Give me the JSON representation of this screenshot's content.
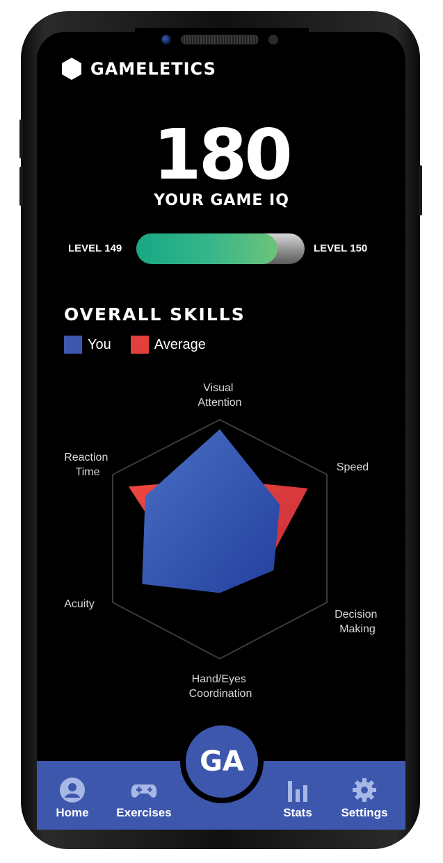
{
  "app": {
    "brand_name": "GAMELETICS"
  },
  "score": {
    "value": "180",
    "label": "YOUR GAME IQ"
  },
  "level": {
    "current": "LEVEL 149",
    "next": "LEVEL 150",
    "progress": 0.84
  },
  "skills": {
    "title": "OVERALL SKILLS",
    "legend": [
      {
        "label": "You",
        "color": "#3d57ad"
      },
      {
        "label": "Average",
        "color": "#e2403b"
      }
    ],
    "axes": {
      "visual_attention": [
        "Visual",
        "Attention"
      ],
      "speed": [
        "Speed"
      ],
      "decision_making": [
        "Decision",
        "Making"
      ],
      "hand_eyes": [
        "Hand/Eyes",
        "Coordination"
      ],
      "acuity": [
        "Acuity"
      ],
      "reaction_time": [
        "Reaction",
        "Time"
      ]
    },
    "values": {
      "you": [
        0.92,
        0.58,
        0.52,
        0.45,
        0.75,
        0.72
      ],
      "average": [
        0.5,
        0.85,
        0.45,
        0.3,
        0.4,
        0.88
      ]
    }
  },
  "nav": {
    "home": "Home",
    "exercises": "Exercises",
    "center": "GA",
    "stats": "Stats",
    "settings": "Settings"
  }
}
